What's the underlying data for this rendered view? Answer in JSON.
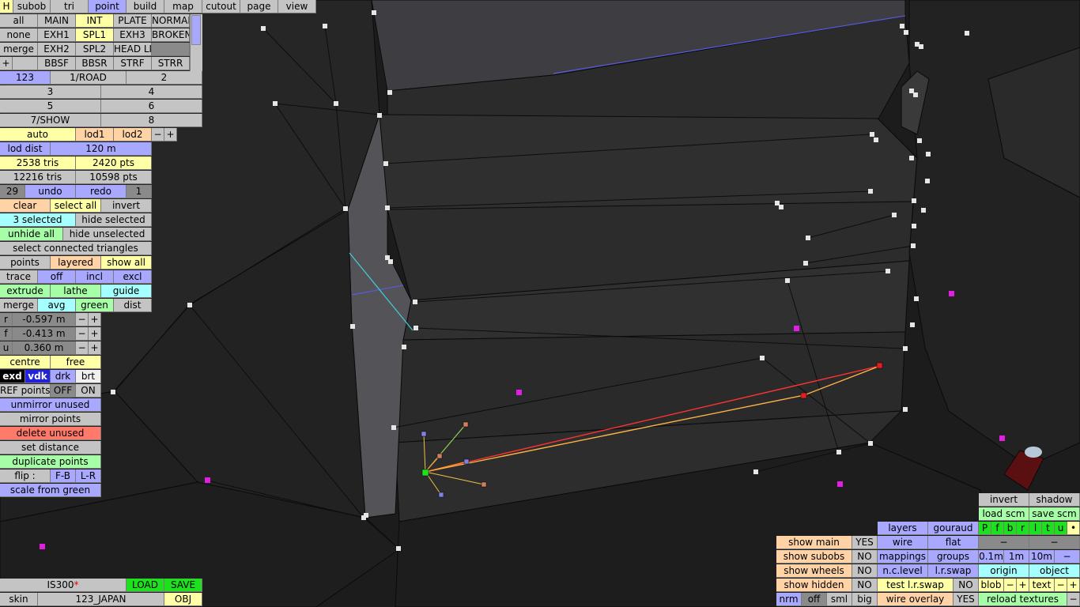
{
  "tabs": {
    "h": "H",
    "subob": "subob",
    "tri": "tri",
    "point": "point",
    "build": "build",
    "map": "map",
    "cutout": "cutout",
    "page": "page",
    "view": "view"
  },
  "groups": {
    "row1": [
      "all",
      "MAIN",
      "INT",
      "PLATE",
      "NORMAL"
    ],
    "row2": [
      "none",
      "EXH1",
      "SPL1",
      "EXH3",
      "BROKEN"
    ],
    "row3": [
      "merge",
      "EXH2",
      "SPL2",
      "HEAD LI",
      ""
    ],
    "row4": [
      "+",
      "",
      "BBSF",
      "BBSR",
      "STRF",
      "STRR"
    ]
  },
  "lods": {
    "a": "123",
    "b": "1/ROAD",
    "c": "2",
    "d": "3",
    "e": "4",
    "f": "5",
    "g": "6",
    "h": "7/SHOW",
    "i": "8"
  },
  "lod": {
    "auto": "auto",
    "lod1": "lod1",
    "lod2": "lod2",
    "minus": "−",
    "plus": "+",
    "dist_label": "lod dist",
    "dist_value": "120 m"
  },
  "stats": {
    "tris": "2538 tris",
    "pts": "2420 pts",
    "total_tris": "12216 tris",
    "total_pts": "10598 pts"
  },
  "undo": {
    "count_left": "29",
    "undo": "undo",
    "redo": "redo",
    "count_right": "1"
  },
  "selection": {
    "clear": "clear",
    "select_all": "select all",
    "invert": "invert",
    "selected": "3 selected",
    "hide_selected": "hide selected",
    "unhide_all": "unhide all",
    "hide_unselected": "hide unselected",
    "select_connected": "select connected triangles"
  },
  "display": {
    "points": "points",
    "layered": "layered",
    "show_all": "show all"
  },
  "trace": {
    "label": "trace",
    "off": "off",
    "incl": "incl",
    "excl": "excl"
  },
  "ops": {
    "extrude": "extrude",
    "lathe": "lathe",
    "guide": "guide",
    "merge": "merge",
    "avg": "avg",
    "green": "green",
    "dist": "dist"
  },
  "coords": {
    "r_label": "r",
    "r_value": "-0.597 m",
    "f_label": "f",
    "f_value": "-0.413 m",
    "u_label": "u",
    "u_value": "0.360 m",
    "minus": "−",
    "plus": "+"
  },
  "pivot": {
    "centre": "centre",
    "free": "free"
  },
  "shade": {
    "exd": "exd",
    "vdk": "vdk",
    "drk": "drk",
    "brt": "brt"
  },
  "ref": {
    "label": "REF points",
    "off": "OFF",
    "on": "ON"
  },
  "actions": {
    "unmirror": "unmirror unused",
    "mirror": "mirror points",
    "delete": "delete unused",
    "set_distance": "set distance",
    "duplicate": "duplicate points",
    "flip": "flip :",
    "fb": "F-B",
    "lr": "L-R",
    "scale": "scale from green"
  },
  "file": {
    "name": "IS300",
    "modified": "*",
    "load": "LOAD",
    "save": "SAVE",
    "skin_label": "skin",
    "skin_value": "123_JAPAN",
    "obj": "OBJ"
  },
  "right_panel": {
    "invert": "invert",
    "shadow": "shadow",
    "load_scm": "load scm",
    "save_scm": "save scm",
    "flags": [
      "P",
      "f",
      "b",
      "r",
      "l",
      "t",
      "u",
      "•"
    ],
    "layers": "layers",
    "gouraud": "gouraud",
    "dash1": "−",
    "dash2": "−",
    "wire": "wire",
    "flat": "flat",
    "show_main": "show main",
    "show_main_v": "YES",
    "show_subobs": "show subobs",
    "show_subobs_v": "NO",
    "show_wheels": "show wheels",
    "show_wheels_v": "NO",
    "show_hidden": "show hidden",
    "show_hidden_v": "NO",
    "mappings": "mappings",
    "groups": "groups",
    "s01": "0.1m",
    "s1": "1m",
    "s10": "10m",
    "sm": "−",
    "nclevel": "n.c.level",
    "lrswap": "l.r.swap",
    "origin": "origin",
    "object": "object",
    "test_lrswap": "test l.r.swap",
    "test_lrswap_v": "NO",
    "blob": "blob",
    "text": "text",
    "pm_minus": "−",
    "pm_plus": "+",
    "nrm": "nrm",
    "off": "off",
    "sml": "sml",
    "big": "big",
    "wire_overlay": "wire overlay",
    "wire_overlay_v": "YES",
    "reload": "reload textures",
    "reload_minus": "−"
  }
}
